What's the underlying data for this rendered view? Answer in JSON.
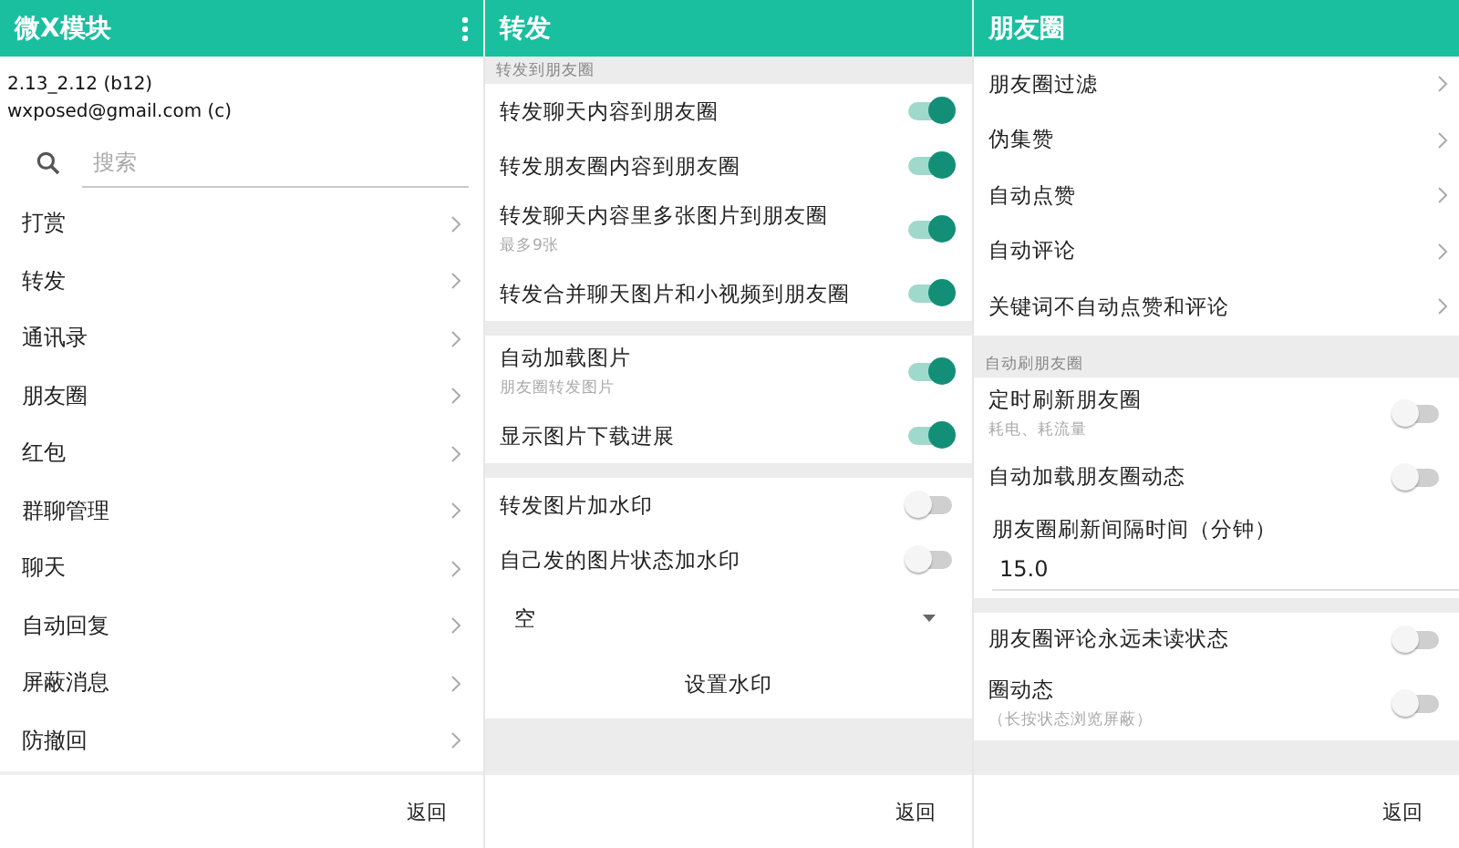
{
  "panels": [
    {
      "kind": "menu",
      "title": "微X模块",
      "version": "2.13_2.12 (b12)",
      "email": "wxposed@gmail.com (c)",
      "search": {
        "placeholder": "搜索"
      },
      "items": [
        "打赏",
        "转发",
        "通讯录",
        "朋友圈",
        "红包",
        "群聊管理",
        "聊天",
        "自动回复",
        "屏蔽消息",
        "防撤回"
      ],
      "footer_button": "返回"
    },
    {
      "kind": "settings",
      "title": "转发",
      "groups": [
        {
          "header": "转发到朋友圈",
          "rows": [
            {
              "kind": "switch",
              "label": "转发聊天内容到朋友圈",
              "on": true
            },
            {
              "kind": "switch",
              "label": "转发朋友圈内容到朋友圈",
              "on": true
            },
            {
              "kind": "switch",
              "label": "转发聊天内容里多张图片到朋友圈",
              "summary": "最多9张",
              "on": true
            },
            {
              "kind": "switch",
              "label": "转发合并聊天图片和小视频到朋友圈",
              "on": true
            }
          ]
        },
        {
          "rows": [
            {
              "kind": "switch",
              "label": "自动加载图片",
              "summary": "朋友圈转发图片",
              "on": true
            },
            {
              "kind": "switch",
              "label": "显示图片下载进展",
              "on": true
            }
          ]
        },
        {
          "rows": [
            {
              "kind": "switch",
              "label": "转发图片加水印",
              "on": false
            },
            {
              "kind": "switch",
              "label": "自己发的图片状态加水印",
              "on": false
            },
            {
              "kind": "dropdown",
              "value": "空"
            },
            {
              "kind": "button",
              "label": "设置水印"
            }
          ]
        }
      ],
      "footer_button": "返回"
    },
    {
      "kind": "settings",
      "title": "朋友圈",
      "groups": [
        {
          "rows": [
            {
              "kind": "nav",
              "label": "朋友圈过滤"
            },
            {
              "kind": "nav",
              "label": "伪集赞"
            },
            {
              "kind": "nav",
              "label": "自动点赞"
            },
            {
              "kind": "nav",
              "label": "自动评论"
            },
            {
              "kind": "nav",
              "label": "关键词不自动点赞和评论"
            }
          ]
        },
        {
          "header": "自动刷朋友圈",
          "rows": [
            {
              "kind": "switch",
              "label": "定时刷新朋友圈",
              "summary": "耗电、耗流量",
              "on": false
            },
            {
              "kind": "switch",
              "label": "自动加载朋友圈动态",
              "on": false
            },
            {
              "kind": "edit",
              "label": "朋友圈刷新间隔时间（分钟）",
              "value": "15.0"
            }
          ]
        },
        {
          "rows": [
            {
              "kind": "switch",
              "label": "朋友圈评论永远未读状态",
              "on": false
            },
            {
              "kind": "switch",
              "label": "圈动态",
              "summary": "（长按状态浏览屏蔽）",
              "on": false
            }
          ]
        }
      ],
      "footer_button": "返回"
    }
  ]
}
